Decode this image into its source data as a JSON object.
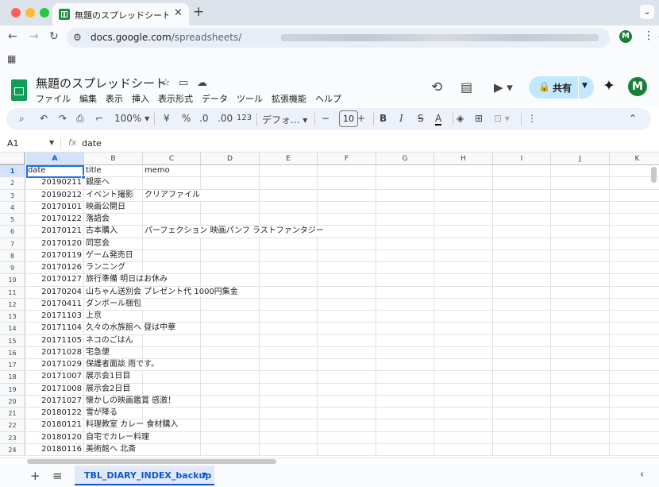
{
  "browser": {
    "tab_title": "無題のスプレッドシート - Google",
    "close": "✕",
    "new_tab": "+",
    "url_host": "docs.google.com",
    "url_path": "/spreadsheets/",
    "profile_initial": "M"
  },
  "doc": {
    "title": "無題のスプレッドシート",
    "menus": [
      "ファイル",
      "編集",
      "表示",
      "挿入",
      "表示形式",
      "データ",
      "ツール",
      "拡張機能",
      "ヘルプ"
    ],
    "share_label": "共有",
    "avatar_initial": "M"
  },
  "toolbar": {
    "zoom": "100%",
    "currency": "¥",
    "percent": "%",
    "dec_less": ".0",
    "dec_more": ".00",
    "number_fmt": "123",
    "font": "デフォ...",
    "font_size": "10",
    "bold": "B",
    "italic": "I",
    "strike": "S",
    "text_color": "A"
  },
  "formula_bar": {
    "cell_ref": "A1",
    "fx": "fx",
    "value": "date"
  },
  "grid": {
    "columns": [
      "A",
      "B",
      "C",
      "D",
      "E",
      "F",
      "G",
      "H",
      "I",
      "J",
      "K"
    ],
    "rows": [
      {
        "n": "1",
        "a": "date",
        "b": "title",
        "c": "memo"
      },
      {
        "n": "2",
        "a": "20190211",
        "b": "銀座へ",
        "c": ""
      },
      {
        "n": "3",
        "a": "20190212",
        "b": "イベント撮影",
        "c": "クリアファイル"
      },
      {
        "n": "4",
        "a": "20170101",
        "b": "映画公開日",
        "c": ""
      },
      {
        "n": "5",
        "a": "20170122",
        "b": "落語会",
        "c": ""
      },
      {
        "n": "6",
        "a": "20170121",
        "b": "古本購入",
        "c": "パーフェクション 映画パンフ ラストファンタジー"
      },
      {
        "n": "7",
        "a": "20170120",
        "b": "同窓会",
        "c": ""
      },
      {
        "n": "8",
        "a": "20170119",
        "b": "ゲーム発売日",
        "c": ""
      },
      {
        "n": "9",
        "a": "20170126",
        "b": "ランニング",
        "c": ""
      },
      {
        "n": "10",
        "a": "20170127",
        "b": "旅行準備 明日はお休み",
        "c": ""
      },
      {
        "n": "11",
        "a": "20170204",
        "b": "山ちゃん送別会  プレゼント代 1000円集金",
        "c": ""
      },
      {
        "n": "12",
        "a": "20170411",
        "b": "ダンボール梱包",
        "c": ""
      },
      {
        "n": "13",
        "a": "20171103",
        "b": "上京",
        "c": ""
      },
      {
        "n": "14",
        "a": "20171104",
        "b": "久々の水族館へ 昼は中華",
        "c": ""
      },
      {
        "n": "15",
        "a": "20171105",
        "b": "ネコのごはん",
        "c": ""
      },
      {
        "n": "16",
        "a": "20171028",
        "b": "宅急便",
        "c": ""
      },
      {
        "n": "17",
        "a": "20171029",
        "b": "保護者面談 雨です。",
        "c": ""
      },
      {
        "n": "18",
        "a": "20171007",
        "b": "展示会1日目",
        "c": ""
      },
      {
        "n": "19",
        "a": "20171008",
        "b": "展示会2日目",
        "c": ""
      },
      {
        "n": "20",
        "a": "20171027",
        "b": "懐かしの映画鑑賞 感激！",
        "c": ""
      },
      {
        "n": "21",
        "a": "20180122",
        "b": "雪が降る",
        "c": ""
      },
      {
        "n": "22",
        "a": "20180121",
        "b": "料理教室 カレー 食材購入",
        "c": ""
      },
      {
        "n": "23",
        "a": "20180120",
        "b": "自宅でカレー料理",
        "c": ""
      },
      {
        "n": "24",
        "a": "20180116",
        "b": "美術館へ 北斎",
        "c": ""
      }
    ]
  },
  "sheets": {
    "add": "+",
    "list": "≡",
    "active": "TBL_DIARY_INDEX_backup"
  },
  "colors": {
    "accent": "#0b57d0",
    "sheets_green": "#0f9d58",
    "share_bg": "#c2e7ff",
    "toolbar_bg": "#edf2fa"
  }
}
